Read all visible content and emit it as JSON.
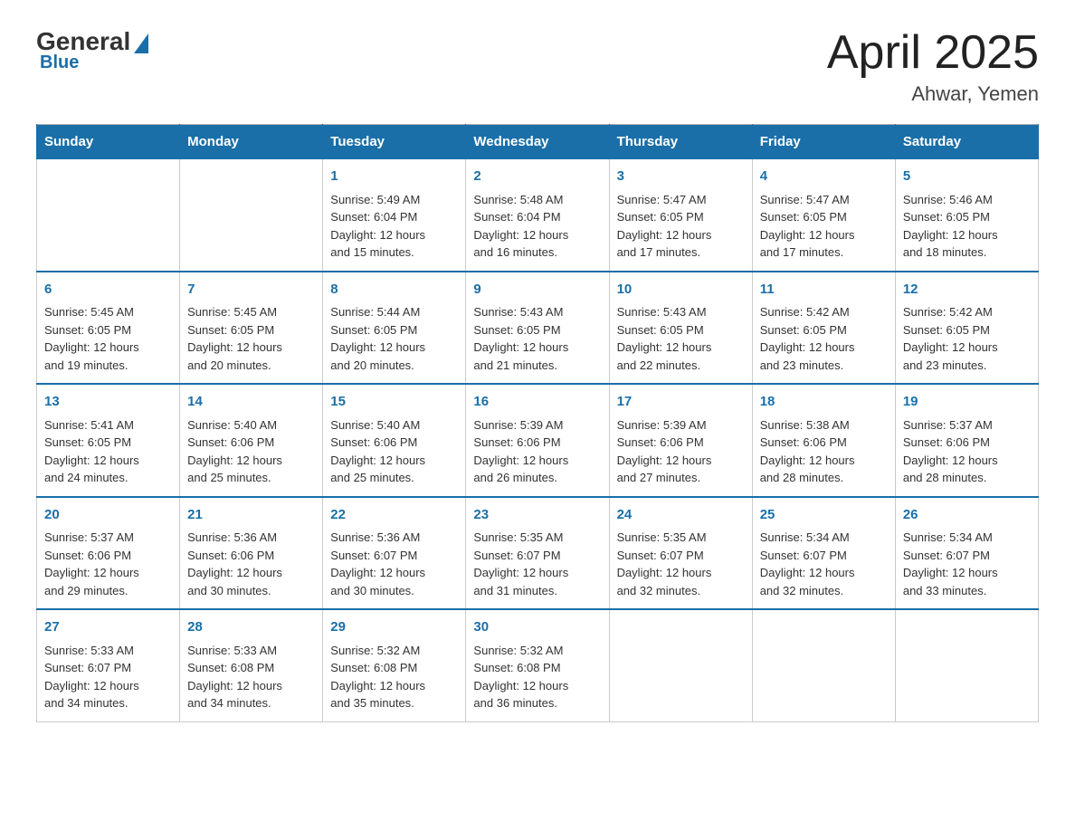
{
  "header": {
    "logo_general": "General",
    "logo_blue": "Blue",
    "month_year": "April 2025",
    "location": "Ahwar, Yemen"
  },
  "days_of_week": [
    "Sunday",
    "Monday",
    "Tuesday",
    "Wednesday",
    "Thursday",
    "Friday",
    "Saturday"
  ],
  "weeks": [
    [
      {
        "day": "",
        "info": ""
      },
      {
        "day": "",
        "info": ""
      },
      {
        "day": "1",
        "info": "Sunrise: 5:49 AM\nSunset: 6:04 PM\nDaylight: 12 hours\nand 15 minutes."
      },
      {
        "day": "2",
        "info": "Sunrise: 5:48 AM\nSunset: 6:04 PM\nDaylight: 12 hours\nand 16 minutes."
      },
      {
        "day": "3",
        "info": "Sunrise: 5:47 AM\nSunset: 6:05 PM\nDaylight: 12 hours\nand 17 minutes."
      },
      {
        "day": "4",
        "info": "Sunrise: 5:47 AM\nSunset: 6:05 PM\nDaylight: 12 hours\nand 17 minutes."
      },
      {
        "day": "5",
        "info": "Sunrise: 5:46 AM\nSunset: 6:05 PM\nDaylight: 12 hours\nand 18 minutes."
      }
    ],
    [
      {
        "day": "6",
        "info": "Sunrise: 5:45 AM\nSunset: 6:05 PM\nDaylight: 12 hours\nand 19 minutes."
      },
      {
        "day": "7",
        "info": "Sunrise: 5:45 AM\nSunset: 6:05 PM\nDaylight: 12 hours\nand 20 minutes."
      },
      {
        "day": "8",
        "info": "Sunrise: 5:44 AM\nSunset: 6:05 PM\nDaylight: 12 hours\nand 20 minutes."
      },
      {
        "day": "9",
        "info": "Sunrise: 5:43 AM\nSunset: 6:05 PM\nDaylight: 12 hours\nand 21 minutes."
      },
      {
        "day": "10",
        "info": "Sunrise: 5:43 AM\nSunset: 6:05 PM\nDaylight: 12 hours\nand 22 minutes."
      },
      {
        "day": "11",
        "info": "Sunrise: 5:42 AM\nSunset: 6:05 PM\nDaylight: 12 hours\nand 23 minutes."
      },
      {
        "day": "12",
        "info": "Sunrise: 5:42 AM\nSunset: 6:05 PM\nDaylight: 12 hours\nand 23 minutes."
      }
    ],
    [
      {
        "day": "13",
        "info": "Sunrise: 5:41 AM\nSunset: 6:05 PM\nDaylight: 12 hours\nand 24 minutes."
      },
      {
        "day": "14",
        "info": "Sunrise: 5:40 AM\nSunset: 6:06 PM\nDaylight: 12 hours\nand 25 minutes."
      },
      {
        "day": "15",
        "info": "Sunrise: 5:40 AM\nSunset: 6:06 PM\nDaylight: 12 hours\nand 25 minutes."
      },
      {
        "day": "16",
        "info": "Sunrise: 5:39 AM\nSunset: 6:06 PM\nDaylight: 12 hours\nand 26 minutes."
      },
      {
        "day": "17",
        "info": "Sunrise: 5:39 AM\nSunset: 6:06 PM\nDaylight: 12 hours\nand 27 minutes."
      },
      {
        "day": "18",
        "info": "Sunrise: 5:38 AM\nSunset: 6:06 PM\nDaylight: 12 hours\nand 28 minutes."
      },
      {
        "day": "19",
        "info": "Sunrise: 5:37 AM\nSunset: 6:06 PM\nDaylight: 12 hours\nand 28 minutes."
      }
    ],
    [
      {
        "day": "20",
        "info": "Sunrise: 5:37 AM\nSunset: 6:06 PM\nDaylight: 12 hours\nand 29 minutes."
      },
      {
        "day": "21",
        "info": "Sunrise: 5:36 AM\nSunset: 6:06 PM\nDaylight: 12 hours\nand 30 minutes."
      },
      {
        "day": "22",
        "info": "Sunrise: 5:36 AM\nSunset: 6:07 PM\nDaylight: 12 hours\nand 30 minutes."
      },
      {
        "day": "23",
        "info": "Sunrise: 5:35 AM\nSunset: 6:07 PM\nDaylight: 12 hours\nand 31 minutes."
      },
      {
        "day": "24",
        "info": "Sunrise: 5:35 AM\nSunset: 6:07 PM\nDaylight: 12 hours\nand 32 minutes."
      },
      {
        "day": "25",
        "info": "Sunrise: 5:34 AM\nSunset: 6:07 PM\nDaylight: 12 hours\nand 32 minutes."
      },
      {
        "day": "26",
        "info": "Sunrise: 5:34 AM\nSunset: 6:07 PM\nDaylight: 12 hours\nand 33 minutes."
      }
    ],
    [
      {
        "day": "27",
        "info": "Sunrise: 5:33 AM\nSunset: 6:07 PM\nDaylight: 12 hours\nand 34 minutes."
      },
      {
        "day": "28",
        "info": "Sunrise: 5:33 AM\nSunset: 6:08 PM\nDaylight: 12 hours\nand 34 minutes."
      },
      {
        "day": "29",
        "info": "Sunrise: 5:32 AM\nSunset: 6:08 PM\nDaylight: 12 hours\nand 35 minutes."
      },
      {
        "day": "30",
        "info": "Sunrise: 5:32 AM\nSunset: 6:08 PM\nDaylight: 12 hours\nand 36 minutes."
      },
      {
        "day": "",
        "info": ""
      },
      {
        "day": "",
        "info": ""
      },
      {
        "day": "",
        "info": ""
      }
    ]
  ]
}
